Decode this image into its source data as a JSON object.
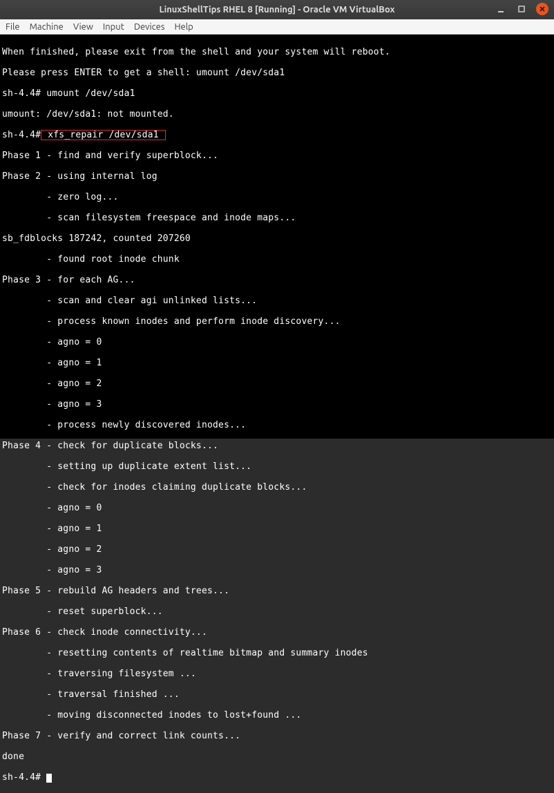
{
  "window": {
    "title": "LinuxShellTips RHEL 8 [Running] - Oracle VM VirtualBox"
  },
  "menu": {
    "file": "File",
    "machine": "Machine",
    "view": "View",
    "input": "Input",
    "devices": "Devices",
    "help": "Help"
  },
  "terminal": {
    "lines": [
      "When finished, please exit from the shell and your system will reboot.",
      "Please press ENTER to get a shell: umount /dev/sda1",
      "sh-4.4# umount /dev/sda1",
      "umount: /dev/sda1: not mounted.",
      "sh-4.4#",
      "Phase 1 - find and verify superblock...",
      "Phase 2 - using internal log",
      "        - zero log...",
      "        - scan filesystem freespace and inode maps...",
      "sb_fdblocks 187242, counted 207260",
      "        - found root inode chunk",
      "Phase 3 - for each AG...",
      "        - scan and clear agi unlinked lists...",
      "        - process known inodes and perform inode discovery...",
      "        - agno = 0",
      "        - agno = 1",
      "        - agno = 2",
      "        - agno = 3",
      "        - process newly discovered inodes...",
      "Phase 4 - check for duplicate blocks...",
      "        - setting up duplicate extent list...",
      "        - check for inodes claiming duplicate blocks...",
      "        - agno = 0",
      "        - agno = 1",
      "        - agno = 2",
      "        - agno = 3",
      "Phase 5 - rebuild AG headers and trees...",
      "        - reset superblock...",
      "Phase 6 - check inode connectivity...",
      "        - resetting contents of realtime bitmap and summary inodes",
      "        - traversing filesystem ...",
      "        - traversal finished ...",
      "        - moving disconnected inodes to lost+found ...",
      "Phase 7 - verify and correct link counts...",
      "done",
      "sh-4.4#"
    ],
    "highlighted_command": " xfs_repair /dev/sda1 ",
    "prompt_before_highlight": "sh-4.4#",
    "final_prompt": "sh-4.4# "
  }
}
